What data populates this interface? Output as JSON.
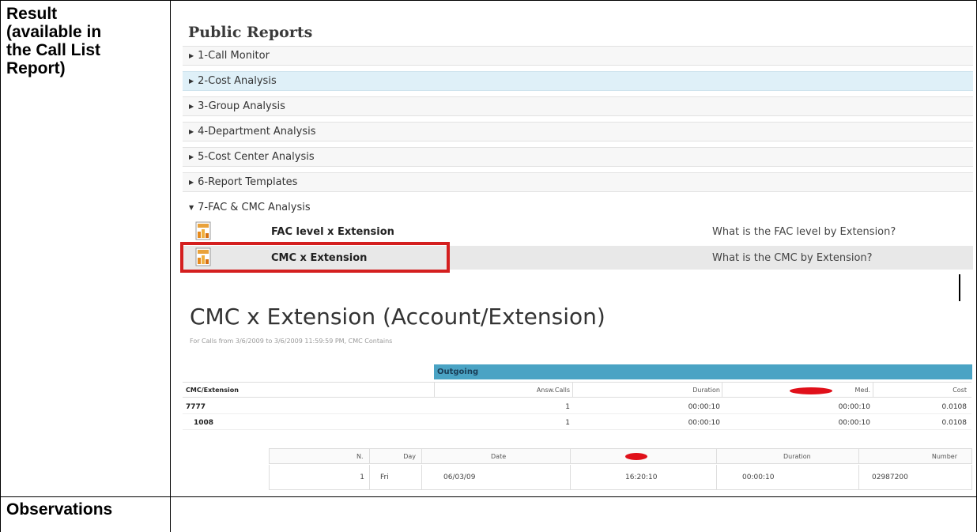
{
  "row_labels": {
    "result": [
      "Result",
      "(available in",
      "the Call List",
      "Report)"
    ],
    "observations": "Observations"
  },
  "public_reports": {
    "title": "Public Reports",
    "folders": [
      {
        "label": "1-Call Monitor",
        "selected": false
      },
      {
        "label": "2-Cost Analysis",
        "selected": true
      },
      {
        "label": "3-Group Analysis",
        "selected": false
      },
      {
        "label": "4-Department Analysis",
        "selected": false
      },
      {
        "label": "5-Cost Center Analysis",
        "selected": false
      },
      {
        "label": "6-Report Templates",
        "selected": false
      },
      {
        "label": "7-FAC & CMC Analysis",
        "selected": false,
        "expanded": true
      }
    ],
    "items": [
      {
        "name": "FAC level x Extension",
        "description": "What is the FAC level by Extension?"
      },
      {
        "name": "CMC x Extension",
        "description": "What is the CMC by Extension?"
      }
    ],
    "highlight_color": "#d41f1f"
  },
  "report": {
    "title": "CMC x Extension (Account/Extension)",
    "subtitle": "For Calls from 3/6/2009 to 3/6/2009 11:59:59 PM, CMC Contains",
    "group_header": "Outgoing",
    "columns": [
      "CMC/Extension",
      "Answ.Calls",
      "Duration",
      "Med.",
      "Cost"
    ],
    "rows": [
      {
        "cmc": "7777",
        "calls": "1",
        "duration": "00:00:10",
        "med": "00:00:10",
        "cost": "0.0108"
      },
      {
        "cmc": "1008",
        "calls": "1",
        "duration": "00:00:10",
        "med": "00:00:10",
        "cost": "0.0108"
      }
    ],
    "detail_columns": [
      "N.",
      "Day",
      "Date",
      "",
      "Duration",
      "Number"
    ],
    "detail_rows": [
      {
        "n": "1",
        "day": "Fri",
        "date": "06/03/09",
        "time": "16:20:10",
        "duration": "00:00:10",
        "number": "02987200"
      }
    ],
    "accent_color": "#4aa3c4"
  }
}
